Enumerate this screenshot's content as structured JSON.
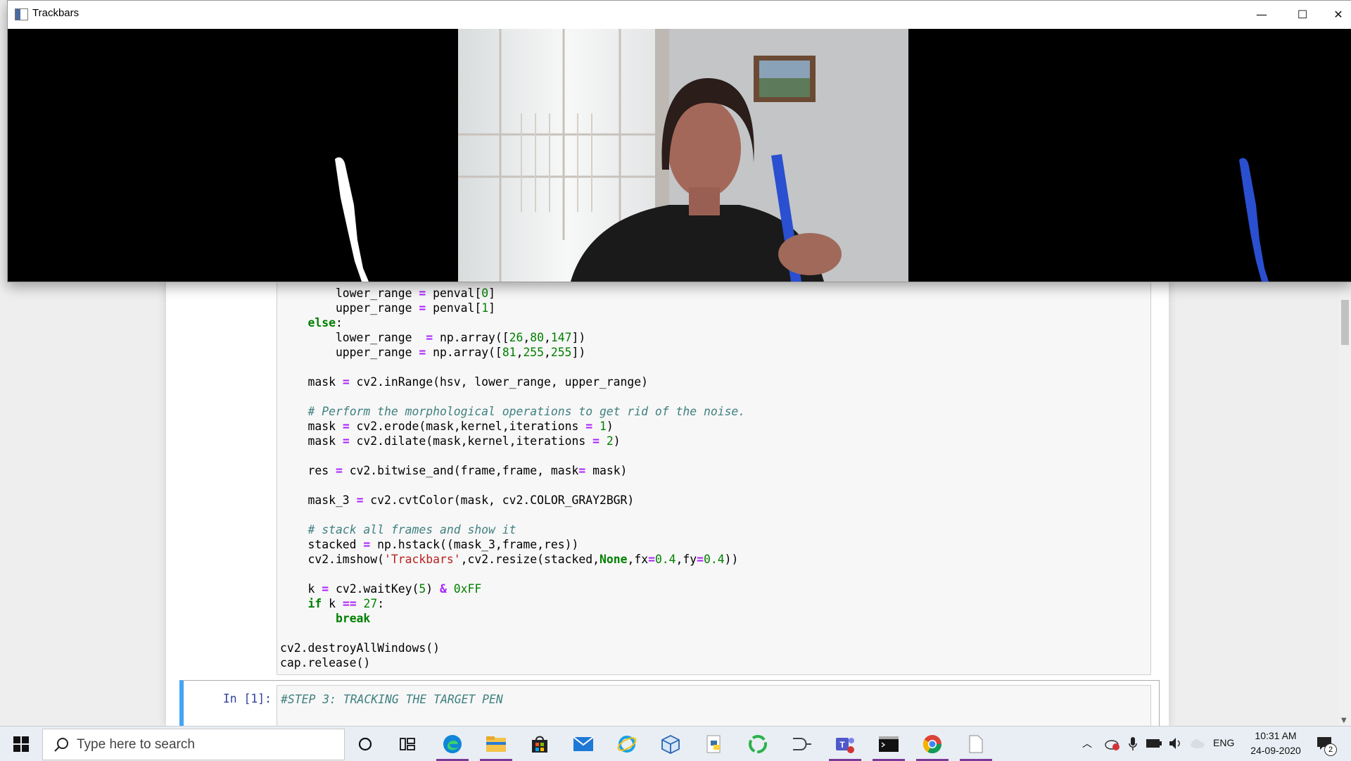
{
  "window": {
    "title": "Trackbars",
    "minimize_glyph": "—",
    "maximize_glyph": "☐",
    "close_glyph": "✕"
  },
  "code": {
    "lines": [
      "        lower_range = penval[0]",
      "        upper_range = penval[1]",
      "    else:",
      "        lower_range  = np.array([26,80,147])",
      "        upper_range = np.array([81,255,255])",
      "",
      "    mask = cv2.inRange(hsv, lower_range, upper_range)",
      "",
      "    # Perform the morphological operations to get rid of the noise.",
      "    mask = cv2.erode(mask,kernel,iterations = 1)",
      "    mask = cv2.dilate(mask,kernel,iterations = 2)",
      "",
      "    res = cv2.bitwise_and(frame,frame, mask= mask)",
      "",
      "    mask_3 = cv2.cvtColor(mask, cv2.COLOR_GRAY2BGR)",
      "",
      "    # stack all frames and show it",
      "    stacked = np.hstack((mask_3,frame,res))",
      "    cv2.imshow('Trackbars',cv2.resize(stacked,None,fx=0.4,fy=0.4))",
      "",
      "    k = cv2.waitKey(5) & 0xFF",
      "    if k == 27:",
      "        break",
      "",
      "cv2.destroyAllWindows()",
      "cap.release()"
    ]
  },
  "next_cell": {
    "prompt": "In [1]:",
    "first_line": "#STEP 3: TRACKING THE TARGET PEN"
  },
  "taskbar": {
    "search_placeholder": "Type here to search",
    "apps": [
      "task-view",
      "edge",
      "file-explorer",
      "store",
      "mail",
      "internet-explorer",
      "box-app",
      "python",
      "green-circle-app",
      "gate-app",
      "teams",
      "terminal",
      "chrome",
      "notepad"
    ],
    "language": "ENG",
    "time": "10:31 AM",
    "date": "24-09-2020",
    "notification_count": "2"
  },
  "colors": {
    "pen_blue": "#2a4fd0",
    "kw_green": "#008000",
    "comment": "#408080",
    "selected_cell_bar": "#42a5f5"
  }
}
